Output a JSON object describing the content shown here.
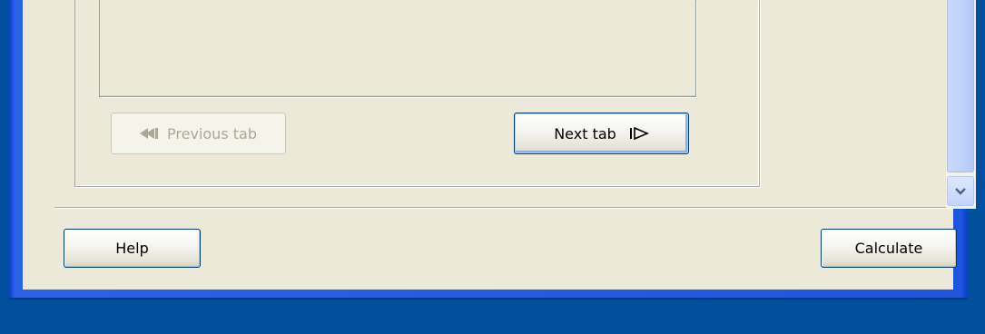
{
  "wizard": {
    "previous_tab_label": "Previous tab",
    "next_tab_label": "Next tab",
    "previous_tab_enabled": false
  },
  "footer": {
    "help_label": "Help",
    "calculate_label": "Calculate"
  },
  "icons": {
    "previous": "rewind-left-icon",
    "next": "play-right-icon",
    "scroll_down": "chevron-down-icon"
  },
  "colors": {
    "desktop": "#00509e",
    "window_frame": "#2a62e8",
    "dialog_face": "#ece9d8",
    "button_border": "#003c74",
    "disabled_text": "#aca899",
    "scroll_thumb": "#c1d3fb"
  }
}
